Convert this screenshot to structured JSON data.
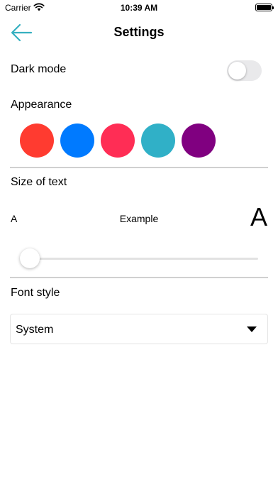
{
  "status_bar": {
    "carrier": "Carrier",
    "time": "10:39 AM"
  },
  "nav": {
    "title": "Settings",
    "back_icon": "back-arrow-icon",
    "back_color": "#36b0c0"
  },
  "dark_mode": {
    "label": "Dark mode",
    "enabled": false
  },
  "appearance": {
    "label": "Appearance",
    "colors": [
      "#ff3b30",
      "#007aff",
      "#ff2d55",
      "#30b0c7",
      "#800080"
    ]
  },
  "text_size": {
    "label": "Size of text",
    "small_label": "A",
    "example_label": "Example",
    "large_label": "A",
    "value": 0
  },
  "font_style": {
    "label": "Font style",
    "selected": "System"
  }
}
